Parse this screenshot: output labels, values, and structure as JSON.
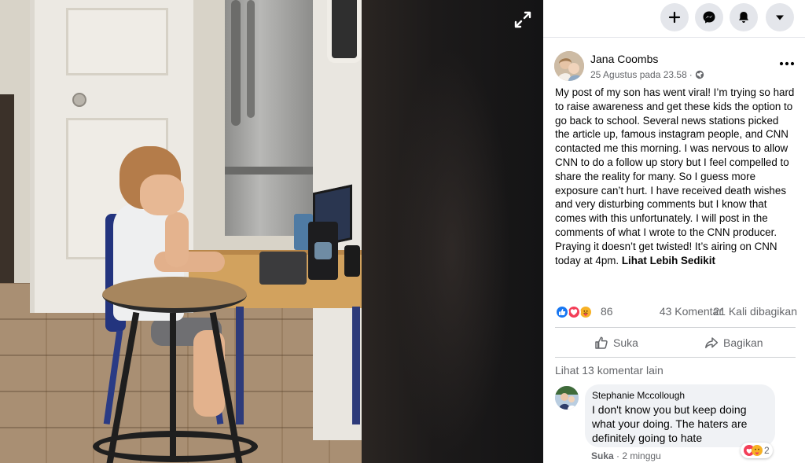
{
  "viewer": {
    "expand_icon": "expand-arrows-icon"
  },
  "topbar": {
    "buttons": [
      {
        "name": "create",
        "icon": "plus-icon"
      },
      {
        "name": "messenger",
        "icon": "messenger-icon"
      },
      {
        "name": "notifications",
        "icon": "bell-icon"
      },
      {
        "name": "account",
        "icon": "caret-down-icon"
      }
    ]
  },
  "post": {
    "author": "Jana Coombs",
    "date": "25 Agustus pada 23.58",
    "separator": "·",
    "audience_icon": "globe-icon",
    "more_icon": "more-dots-icon",
    "text": "My post of my son has went viral! I’m trying so hard to raise awareness and get these kids the option to go back to school. Several news stations picked the article up, famous instagram people, and CNN contacted me this morning. I was nervous to allow CNN to do a follow up story but I feel compelled to share the reality for many. So I guess more exposure can’t hurt. I have received death wishes and very disturbing comments but I know that comes with this unfortunately. I will post in the comments of what I wrote to the CNN producer. Praying it doesn’t get twisted! It’s airing on CNN today at 4pm. ",
    "see_less": "Lihat Lebih Sedikit",
    "reactions": {
      "types": [
        "like",
        "love",
        "care"
      ],
      "count": "86",
      "comments": "43 Komentar",
      "shares": "21 Kali dibagikan"
    },
    "actions": {
      "like": "Suka",
      "share": "Bagikan"
    },
    "more_comments": "Lihat 13 komentar lain"
  },
  "comment": {
    "author": "Stephanie Mccollough",
    "text": "I don't know you but keep doing what your doing. The haters are definitely going to hate",
    "reaction_count": "2",
    "like_label": "Suka",
    "separator": "·",
    "time": "2 minggu"
  },
  "colors": {
    "like_blue": "#1877f2",
    "love_red": "#f33e58",
    "care_yellow": "#f7b125",
    "secondary_text": "#65676b"
  }
}
